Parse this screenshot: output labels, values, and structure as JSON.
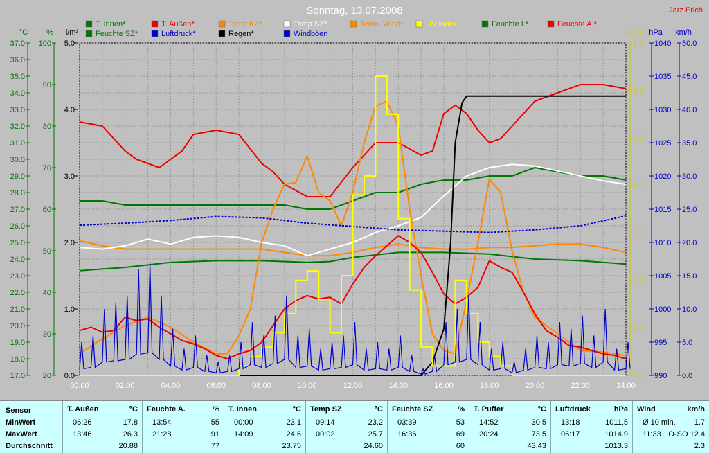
{
  "chart_data": {
    "type": "line",
    "title": "Sonntag, 13.07.2008",
    "author": "Jarz Erich",
    "x_ticks": [
      "00:00",
      "02:00",
      "04:00",
      "06:00",
      "08:00",
      "10:00",
      "12:00",
      "14:00",
      "16:00",
      "18:00",
      "20:00",
      "22:00",
      "24:00"
    ],
    "xlim": [
      0,
      24
    ],
    "axes": {
      "temp_c": {
        "label": "°C",
        "ticks": [
          "37.0",
          "36.0",
          "35.0",
          "34.0",
          "33.0",
          "32.0",
          "31.0",
          "30.0",
          "29.0",
          "28.0",
          "27.0",
          "26.0",
          "25.0",
          "24.0",
          "23.0",
          "22.0",
          "21.0",
          "20.0",
          "19.0",
          "18.0",
          "17.0"
        ],
        "ylim": [
          17,
          37
        ],
        "color": "#007700"
      },
      "humidity_pct": {
        "label": "%",
        "ticks": [
          "100",
          "90",
          "80",
          "70",
          "60",
          "50",
          "40",
          "30",
          "20"
        ],
        "ylim": [
          20,
          100
        ],
        "color": "#007700"
      },
      "rain_lm2": {
        "label": "l/m²",
        "ticks": [
          "5.0",
          "4.0",
          "3.0",
          "2.0",
          "1.0",
          "0.0"
        ],
        "ylim": [
          0,
          5
        ],
        "color": "#000000"
      },
      "uv": {
        "label": "UV-I",
        "ticks": [
          "7.0",
          "6.0",
          "5.0",
          "4.0",
          "3.0",
          "2.0",
          "1.0",
          "0.0"
        ],
        "ylim": [
          0,
          7
        ],
        "color": "#cccc00"
      },
      "pressure_hpa": {
        "label": "hPa",
        "ticks": [
          "1040",
          "1035",
          "1030",
          "1025",
          "1020",
          "1015",
          "1010",
          "1005",
          "1000",
          "995",
          "990"
        ],
        "ylim": [
          990,
          1040
        ],
        "color": "#0000cc"
      },
      "wind_kmh": {
        "label": "km/h",
        "ticks": [
          "50.0",
          "45.0",
          "40.0",
          "35.0",
          "30.0",
          "25.0",
          "20.0",
          "15.0",
          "10.0",
          "5.0",
          "0.0"
        ],
        "ylim": [
          0,
          50
        ],
        "color": "#0000cc"
      }
    },
    "legend": [
      {
        "name": "T. Innen*",
        "color": "#007700"
      },
      {
        "name": "T. Außen*",
        "color": "#ee0000"
      },
      {
        "name": "Temp KZ*",
        "color": "#ff8800"
      },
      {
        "name": "Temp SZ*",
        "color": "#ffffff"
      },
      {
        "name": "Temp. Wind*",
        "color": "#ff8800"
      },
      {
        "name": "UV Index",
        "color": "#ffff00"
      },
      {
        "name": "Feuchte I.*",
        "color": "#007700"
      },
      {
        "name": "Feuchte A.*",
        "color": "#ee0000"
      },
      {
        "name": "Feuchte SZ*",
        "color": "#007700"
      },
      {
        "name": "Luftdruck*",
        "color": "#0000cc"
      },
      {
        "name": "Regen*",
        "color": "#000000"
      },
      {
        "name": "Windböen",
        "color": "#0000cc"
      }
    ],
    "series": [
      {
        "name": "T. Innen*",
        "axis": "temp_c",
        "style": "solid",
        "color": "#007700",
        "x": [
          0,
          2,
          4,
          6,
          8,
          10,
          11,
          12,
          13,
          14,
          16,
          18,
          20,
          22,
          24
        ],
        "y": [
          23.3,
          23.5,
          23.8,
          23.9,
          23.9,
          23.8,
          23.85,
          24.1,
          24.25,
          24.4,
          24.4,
          24.3,
          24.0,
          23.9,
          23.7
        ]
      },
      {
        "name": "Feuchte SZ*",
        "axis": "humidity_pct",
        "style": "solid",
        "color": "#007700",
        "x": [
          0,
          1,
          2,
          3,
          4,
          5,
          6,
          7,
          8,
          9,
          10,
          11,
          12,
          13,
          14,
          15,
          16,
          17,
          18,
          19,
          20,
          21,
          22,
          23,
          24
        ],
        "y": [
          62,
          62,
          61,
          61,
          61,
          61,
          61,
          61,
          61,
          61,
          60,
          60,
          62,
          64,
          64,
          66,
          67,
          67,
          68,
          68,
          70,
          69,
          68,
          68,
          67
        ]
      },
      {
        "name": "Feuchte A.*",
        "axis": "humidity_pct",
        "style": "solid",
        "color": "#ee0000",
        "x": [
          0,
          1,
          2,
          2.5,
          3,
          3.5,
          4,
          4.5,
          5,
          6,
          7,
          8,
          8.5,
          9,
          10,
          11,
          12,
          13,
          14,
          15,
          15.5,
          16,
          16.5,
          17,
          17.5,
          18,
          18.5,
          19,
          20,
          21,
          22,
          23,
          24
        ],
        "y": [
          81,
          80,
          74,
          72,
          71,
          70,
          72,
          74,
          78,
          79,
          78,
          71,
          69,
          66,
          63,
          63,
          70,
          76,
          76,
          73,
          74,
          83,
          85,
          83,
          79,
          76,
          77,
          80,
          86,
          88,
          90,
          90,
          89
        ]
      },
      {
        "name": "Temp KZ*",
        "axis": "temp_c",
        "style": "solid",
        "color": "#ff8800",
        "x": [
          0,
          1,
          2,
          4,
          6,
          7,
          8,
          9,
          10,
          11,
          12,
          13,
          14,
          15,
          16,
          17,
          18,
          19,
          20,
          21,
          22,
          23,
          24
        ],
        "y": [
          25.1,
          24.8,
          24.6,
          24.6,
          24.6,
          24.6,
          24.6,
          24.4,
          24.2,
          24.2,
          24.4,
          24.7,
          24.9,
          24.7,
          24.6,
          24.6,
          24.7,
          24.7,
          24.8,
          24.9,
          24.9,
          24.7,
          24.4
        ]
      },
      {
        "name": "Temp SZ*",
        "axis": "temp_c",
        "style": "solid",
        "color": "#ffffff",
        "x": [
          0,
          1,
          2,
          3,
          4,
          5,
          6,
          7,
          8,
          9,
          10,
          11,
          12,
          13,
          14,
          15,
          16,
          17,
          18,
          19,
          20,
          21,
          22,
          23,
          24
        ],
        "y": [
          24.7,
          24.6,
          24.8,
          25.2,
          24.9,
          25.3,
          25.4,
          25.3,
          25.0,
          24.8,
          24.2,
          24.6,
          25.0,
          25.6,
          26.0,
          26.5,
          27.8,
          29.0,
          29.5,
          29.7,
          29.6,
          29.3,
          29.0,
          28.7,
          28.5
        ]
      },
      {
        "name": "Temp. Wind*",
        "axis": "temp_c",
        "style": "solid",
        "color": "#ff8800",
        "x": [
          0,
          1,
          2,
          3,
          4,
          5,
          6,
          6.5,
          7,
          7.5,
          8,
          8.5,
          9,
          9.5,
          10,
          10.5,
          11,
          11.5,
          12,
          12.5,
          13,
          13.5,
          14,
          14.5,
          15,
          15.5,
          16,
          16.5,
          17,
          17.5,
          18,
          18.5,
          19,
          19.5,
          20,
          21,
          22,
          23,
          24
        ],
        "y": [
          18.3,
          19.2,
          20.0,
          20.5,
          19.9,
          19.0,
          18.3,
          18.3,
          19.4,
          21.0,
          25.0,
          27.0,
          28.5,
          28.6,
          30.2,
          28.0,
          27.5,
          26.0,
          28.0,
          31.0,
          33.2,
          33.5,
          32.0,
          27.0,
          23.0,
          19.5,
          18.5,
          18.3,
          21.5,
          25.0,
          28.8,
          28.0,
          24.5,
          22.0,
          20.5,
          19.5,
          18.5,
          18.4,
          18.2
        ]
      },
      {
        "name": "T. Außen*",
        "axis": "temp_c",
        "style": "solid",
        "color": "#ee0000",
        "x": [
          0,
          0.5,
          1,
          1.5,
          2,
          2.5,
          3,
          3.5,
          4,
          4.5,
          5,
          5.5,
          6,
          6.5,
          7,
          7.5,
          8,
          8.5,
          9,
          9.5,
          10,
          10.5,
          11,
          11.5,
          12,
          12.5,
          13,
          13.5,
          14,
          14.5,
          15,
          15.5,
          16,
          16.5,
          17,
          17.5,
          18,
          18.5,
          19,
          19.5,
          20,
          20.5,
          21,
          21.5,
          22,
          22.5,
          23,
          23.5,
          24
        ],
        "y": [
          19.7,
          19.9,
          19.6,
          19.7,
          20.5,
          20.3,
          20.4,
          19.9,
          19.5,
          19.1,
          18.9,
          18.6,
          18.2,
          18.0,
          18.3,
          18.5,
          19.0,
          20.0,
          21.0,
          21.5,
          21.8,
          21.6,
          21.7,
          21.3,
          22.5,
          23.5,
          24.2,
          24.8,
          25.4,
          25.0,
          24.4,
          23.2,
          21.9,
          21.3,
          21.7,
          22.3,
          23.9,
          23.5,
          23.2,
          22.0,
          20.7,
          19.7,
          19.3,
          18.8,
          18.7,
          18.5,
          18.3,
          18.2,
          18.0
        ]
      },
      {
        "name": "Luftdruck*",
        "axis": "pressure_hpa",
        "style": "dashed",
        "color": "#0000cc",
        "x": [
          0,
          2,
          4,
          6,
          8,
          10,
          12,
          14,
          16,
          18,
          20,
          22,
          24
        ],
        "y": [
          1012.6,
          1012.9,
          1013.3,
          1013.9,
          1013.7,
          1012.9,
          1012.4,
          1011.9,
          1011.7,
          1011.5,
          1011.9,
          1012.5,
          1014.0
        ]
      },
      {
        "name": "Regen*",
        "axis": "rain_lm2",
        "style": "solid",
        "color": "#000000",
        "x": [
          0,
          15,
          15.5,
          16,
          16.3,
          16.5,
          16.8,
          17,
          18,
          20,
          22,
          24
        ],
        "y": [
          0,
          0,
          0.2,
          0.7,
          2.0,
          3.5,
          4.1,
          4.2,
          4.2,
          4.2,
          4.2,
          4.2
        ]
      },
      {
        "name": "UV Index",
        "axis": "uv",
        "style": "step",
        "color": "#ffff00",
        "x": [
          0,
          6.5,
          7,
          7.5,
          8,
          8.5,
          9,
          9.5,
          10,
          10.5,
          11,
          11.5,
          12,
          12.5,
          13,
          13.5,
          14,
          14.5,
          15,
          15.5,
          16,
          16.5,
          17,
          17.5,
          18,
          18.5,
          19,
          24
        ],
        "y": [
          0,
          0,
          0.2,
          0.4,
          0.6,
          0.9,
          1.3,
          2.0,
          2.2,
          1.6,
          0.9,
          2.1,
          3.8,
          4.2,
          6.3,
          5.5,
          3.3,
          1.8,
          0.6,
          0.2,
          0.2,
          2.0,
          1.3,
          0.7,
          0.4,
          0.2,
          0,
          0
        ]
      },
      {
        "name": "Windböen",
        "axis": "wind_kmh",
        "style": "spiky",
        "color": "#0000cc",
        "x": [
          0,
          0.5,
          1,
          1.5,
          2,
          2.5,
          3,
          3.5,
          4,
          4.5,
          5,
          5.5,
          6,
          6.5,
          7,
          7.5,
          8,
          8.5,
          9,
          9.5,
          10,
          10.5,
          11,
          11.5,
          12,
          12.5,
          13,
          13.5,
          14,
          14.5,
          15,
          15.5,
          16,
          16.5,
          17,
          17.5,
          18,
          18.5,
          19,
          19.5,
          20,
          20.5,
          21,
          21.5,
          22,
          22.5,
          23,
          23.5,
          24
        ],
        "y": [
          5,
          6,
          10,
          11,
          12,
          16,
          17,
          12,
          7,
          4,
          6,
          3,
          2,
          3,
          5,
          8,
          6,
          9,
          12,
          6,
          7,
          4,
          5,
          6,
          8,
          4,
          5,
          4,
          6,
          3,
          1,
          3,
          8,
          10,
          12,
          8,
          4,
          5,
          2,
          4,
          6,
          5,
          8,
          7,
          9,
          6,
          10,
          4,
          5
        ]
      }
    ]
  },
  "stats": {
    "row_labels": [
      "Sensor",
      "MinWert",
      "MaxWert",
      "Durchschnitt"
    ],
    "columns": [
      {
        "name": "T. Außen",
        "unit": "°C",
        "min_time": "06:26",
        "min": "17.8",
        "max_time": "13:46",
        "max": "26.3",
        "avg": "20.88"
      },
      {
        "name": "Feuchte A.",
        "unit": "%",
        "min_time": "13:54",
        "min": "55",
        "max_time": "21:28",
        "max": "91",
        "avg": "77"
      },
      {
        "name": "T. Innen",
        "unit": "°C",
        "min_time": "00:00",
        "min": "23.1",
        "max_time": "14:09",
        "max": "24.6",
        "avg": "23.75"
      },
      {
        "name": "Temp SZ",
        "unit": "°C",
        "min_time": "09:14",
        "min": "23.2",
        "max_time": "00:02",
        "max": "25.7",
        "avg": "24.60"
      },
      {
        "name": "Feuchte SZ",
        "unit": "%",
        "min_time": "03:39",
        "min": "53",
        "max_time": "16:36",
        "max": "69",
        "avg": "60"
      },
      {
        "name": "T. Puffer",
        "unit": "°C",
        "min_time": "14:52",
        "min": "30.5",
        "max_time": "20:24",
        "max": "73.5",
        "avg": "43.43"
      },
      {
        "name": "Luftdruck",
        "unit": "hPa",
        "min_time": "13:18",
        "min": "1011.5",
        "max_time": "06:17",
        "max": "1014.9",
        "avg": "1013.3"
      },
      {
        "name": "Wind",
        "unit": "km/h",
        "min_time": "Ø 10 min.",
        "min": "1.7",
        "max_time": "11:33",
        "max": "O-SO 12.4",
        "avg": "2.3"
      }
    ]
  }
}
